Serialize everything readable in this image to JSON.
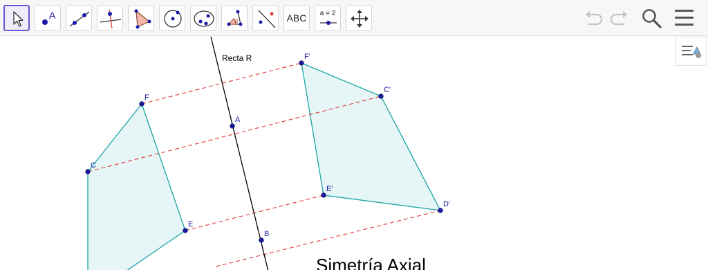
{
  "toolbar": {
    "tools": [
      {
        "name": "move-tool",
        "selected": true
      },
      {
        "name": "point-tool",
        "glyph": "A"
      },
      {
        "name": "line-tool"
      },
      {
        "name": "perpendicular-line-tool"
      },
      {
        "name": "polygon-tool"
      },
      {
        "name": "circle-center-point-tool"
      },
      {
        "name": "conic-tool"
      },
      {
        "name": "angle-tool",
        "glyph": "α"
      },
      {
        "name": "reflect-about-line-tool"
      },
      {
        "name": "text-tool",
        "label": "ABC"
      },
      {
        "name": "slider-tool",
        "label": "a = 2"
      },
      {
        "name": "move-graphics-view-tool"
      }
    ],
    "right_icons": [
      "undo-icon",
      "redo-icon",
      "search-icon",
      "menu-icon"
    ],
    "style_bar_icon": "style-bar-toggle-icon"
  },
  "geometry": {
    "line_label": "Recta R",
    "title": "Simetría Axial",
    "points": {
      "F": "F",
      "C": "C",
      "E": "E",
      "A": "A",
      "B": "B",
      "F_prime": "F'",
      "C_prime": "C'",
      "E_prime": "E'",
      "D_prime": "D'"
    },
    "colors": {
      "polygon_fill": "#e6f5f5",
      "polygon_edge": "#1aa5a5",
      "point": "#1a1aa6",
      "point_label": "#1a1aa6",
      "reflection_line": "#e03a3a",
      "axis_line": "#000000",
      "selected_tool": "#6557d2"
    }
  }
}
